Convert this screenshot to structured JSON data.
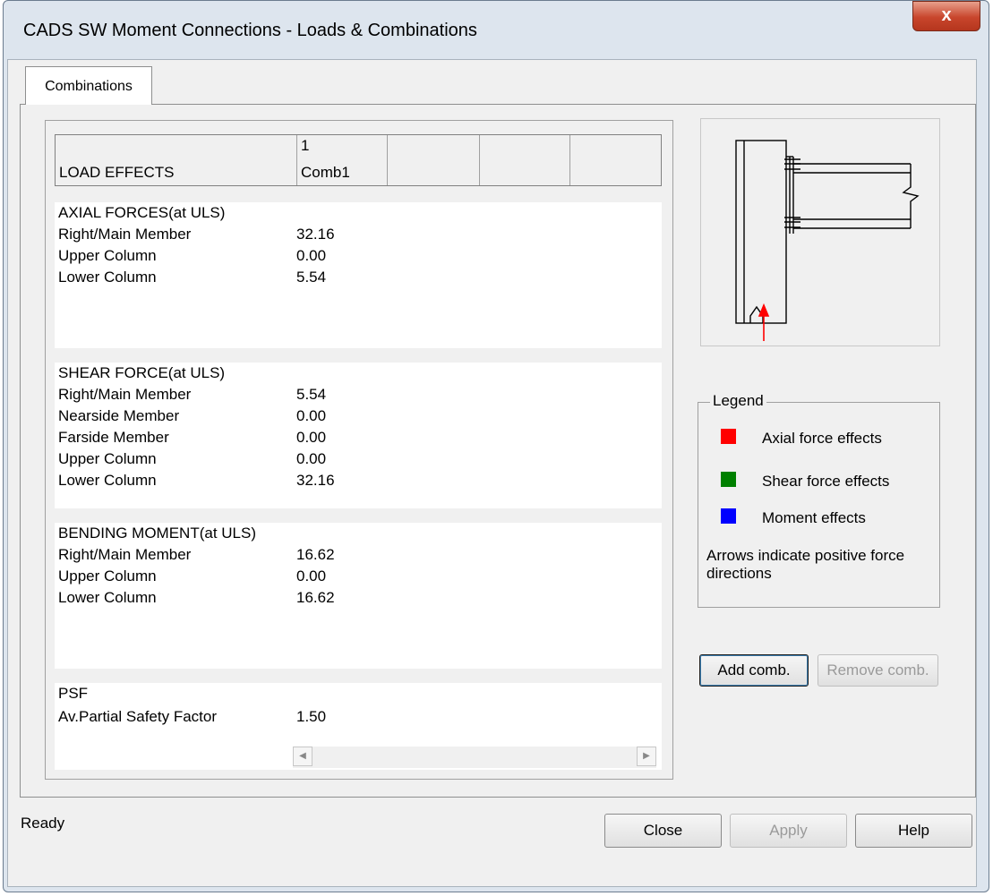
{
  "window": {
    "title": "CADS SW Moment Connections - Loads & Combinations",
    "close_glyph": "x"
  },
  "tab": {
    "label": "Combinations"
  },
  "grid": {
    "header_label": "LOAD EFFECTS",
    "columns": [
      {
        "number": "1",
        "name": "Comb1"
      }
    ],
    "sections": [
      {
        "title": "AXIAL FORCES(at ULS)",
        "rows": [
          {
            "label": "Right/Main Member",
            "value": "32.16"
          },
          {
            "label": "Upper Column",
            "value": "0.00"
          },
          {
            "label": "Lower Column",
            "value": "5.54"
          }
        ]
      },
      {
        "title": "SHEAR FORCE(at ULS)",
        "rows": [
          {
            "label": "Right/Main Member",
            "value": "5.54"
          },
          {
            "label": "Nearside Member",
            "value": "0.00"
          },
          {
            "label": "Farside Member",
            "value": "0.00"
          },
          {
            "label": "Upper Column",
            "value": "0.00"
          },
          {
            "label": "Lower Column",
            "value": "32.16"
          }
        ]
      },
      {
        "title": "BENDING MOMENT(at ULS)",
        "rows": [
          {
            "label": "Right/Main Member",
            "value": "16.62"
          },
          {
            "label": "Upper Column",
            "value": "0.00"
          },
          {
            "label": "Lower Column",
            "value": "16.62"
          }
        ]
      },
      {
        "title": "PSF",
        "rows": [
          {
            "label": "Av.Partial Safety Factor",
            "value": "1.50"
          }
        ]
      }
    ]
  },
  "legend": {
    "title": "Legend",
    "items": [
      {
        "label": "Axial force effects",
        "color": "#ff0000"
      },
      {
        "label": "Shear force effects",
        "color": "#008000"
      },
      {
        "label": "Moment effects",
        "color": "#0000ff"
      }
    ],
    "note": "Arrows indicate positive force directions"
  },
  "buttons": {
    "add_comb": "Add comb.",
    "remove_comb": "Remove comb.",
    "close": "Close",
    "apply": "Apply",
    "help": "Help"
  },
  "status": {
    "text": "Ready"
  }
}
